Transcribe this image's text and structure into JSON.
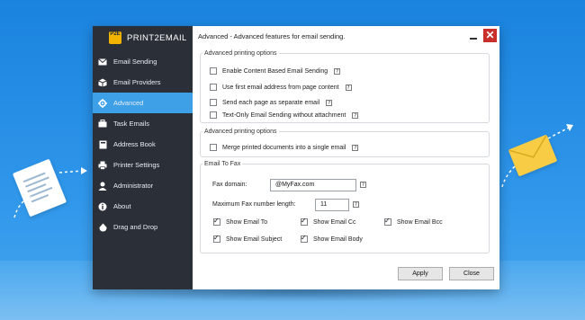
{
  "app": {
    "logo_badge": "P2E",
    "logo_text": "PRINT2EMAIL"
  },
  "sidebar": {
    "items": [
      {
        "label": "Email Sending",
        "icon": "mail-icon"
      },
      {
        "label": "Email Providers",
        "icon": "box-icon"
      },
      {
        "label": "Advanced",
        "icon": "gear-icon",
        "active": true
      },
      {
        "label": "Task Emails",
        "icon": "briefcase-icon"
      },
      {
        "label": "Address Book",
        "icon": "book-icon"
      },
      {
        "label": "Printer Settings",
        "icon": "printer-icon"
      },
      {
        "label": "Administrator",
        "icon": "user-icon"
      },
      {
        "label": "About",
        "icon": "info-icon"
      },
      {
        "label": "Drag and Drop",
        "icon": "drop-icon"
      }
    ]
  },
  "window": {
    "title": "Advanced - Advanced features for email sending.",
    "close_glyph": "✕"
  },
  "group1": {
    "legend": "Advanced printing options",
    "options": [
      {
        "label": "Enable Content Based Email Sending",
        "checked": false
      },
      {
        "label": "Use first email address from page content",
        "checked": false
      },
      {
        "label": "Send each page as separate email",
        "checked": false
      },
      {
        "label": "Text-Only Email Sending without attachment",
        "checked": false
      }
    ]
  },
  "group2": {
    "legend": "Advanced printing options",
    "options": [
      {
        "label": "Merge printed documents into a single email",
        "checked": false
      }
    ]
  },
  "group3": {
    "legend": "Email To Fax",
    "fax_domain_label": "Fax domain:",
    "fax_domain_value": "@MyFax.com",
    "max_len_label": "Maximum Fax number length:",
    "max_len_value": "11",
    "checks": [
      {
        "label": "Show Email To",
        "checked": true
      },
      {
        "label": "Show Email Cc",
        "checked": true
      },
      {
        "label": "Show Email Bcc",
        "checked": true
      },
      {
        "label": "Show Email Subject",
        "checked": true
      },
      {
        "label": "Show Email Body",
        "checked": true
      }
    ]
  },
  "help_glyph": "?",
  "buttons": {
    "apply": "Apply",
    "close": "Close"
  },
  "colors": {
    "accent": "#3ea1e8",
    "sidebar": "#2b3038",
    "close": "#c9302c",
    "background": "#1a83de"
  }
}
